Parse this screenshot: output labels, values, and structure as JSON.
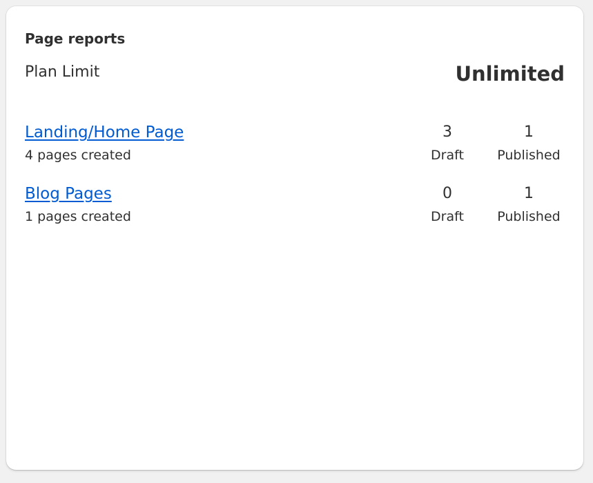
{
  "card": {
    "title": "Page reports",
    "plan_label": "Plan Limit",
    "plan_value": "Unlimited"
  },
  "reports": [
    {
      "name": "Landing/Home Page",
      "subtitle": "4 pages created",
      "draft_count": "3",
      "draft_label": "Draft",
      "published_count": "1",
      "published_label": "Published"
    },
    {
      "name": "Blog Pages",
      "subtitle": "1 pages created",
      "draft_count": "0",
      "draft_label": "Draft",
      "published_count": "1",
      "published_label": "Published"
    }
  ],
  "colors": {
    "link": "#005bd3",
    "text": "#303030",
    "background": "#f1f1f1",
    "card": "#ffffff"
  }
}
